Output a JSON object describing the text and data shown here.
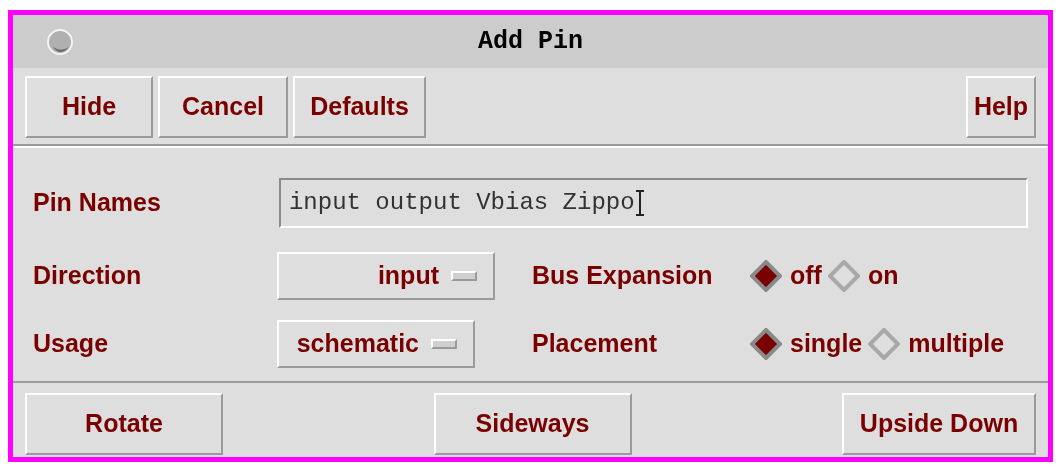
{
  "window": {
    "title": "Add Pin"
  },
  "toolbar": {
    "left": [
      "Hide",
      "Cancel",
      "Defaults"
    ],
    "right": [
      "Help"
    ]
  },
  "pin_names": {
    "label": "Pin Names",
    "value": "input output Vbias Zippo"
  },
  "direction": {
    "label": "Direction",
    "value": "input"
  },
  "usage": {
    "label": "Usage",
    "value": "schematic"
  },
  "bus_expansion": {
    "label": "Bus Expansion",
    "options": [
      {
        "label": "off",
        "selected": true
      },
      {
        "label": "on",
        "selected": false
      }
    ]
  },
  "placement": {
    "label": "Placement",
    "options": [
      {
        "label": "single",
        "selected": true
      },
      {
        "label": "multiple",
        "selected": false
      }
    ]
  },
  "bottom_buttons": [
    "Rotate",
    "Sideways",
    "Upside Down"
  ]
}
